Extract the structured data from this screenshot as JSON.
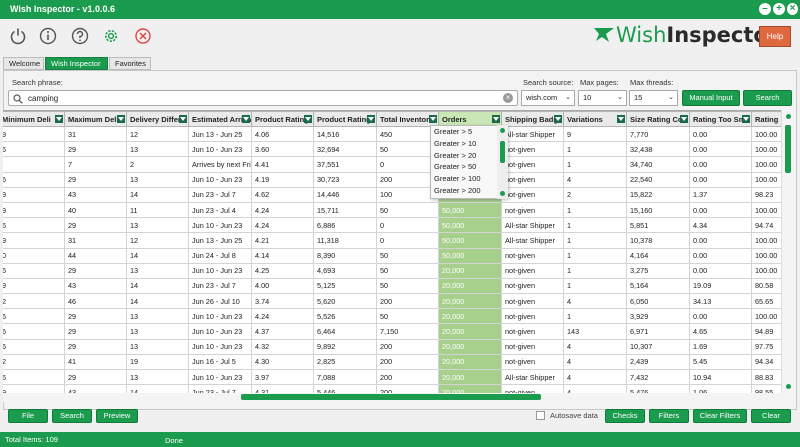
{
  "window": {
    "title": "Wish Inspector - v1.0.0.6"
  },
  "toolbar": {
    "icons": [
      "power-icon",
      "info-icon",
      "help-circle-icon",
      "gear-icon",
      "close-circle-icon"
    ]
  },
  "logo": {
    "part1": "Wish",
    "part2": "Inspector"
  },
  "help_label": "Help",
  "tabs": [
    "Welcome",
    "Wish Inspector",
    "Favorites"
  ],
  "search": {
    "phrase_label": "Search phrase:",
    "value": "camping",
    "source_label": "Search source:",
    "source_value": "wish.com",
    "pages_label": "Max pages:",
    "pages_value": "10",
    "threads_label": "Max threads:",
    "threads_value": "15",
    "manual_label": "Manual Input",
    "search_label": "Search"
  },
  "grid": {
    "columns": [
      "Minimum Deli",
      "Maximum Deli",
      "Delivery Differ",
      "Estimated Arrival",
      "Product Rating",
      "Product Rating",
      "Total Inventor",
      "Orders",
      "Shipping Badge",
      "Variations",
      "Size Rating Co",
      "Rating Too Sm",
      "Rating"
    ],
    "rows": [
      [
        "9",
        "31",
        "12",
        "Jun 13 - Jun 25",
        "4.06",
        "14,516",
        "450",
        "",
        "All-star Shipper",
        "9",
        "7,770",
        "0.00",
        "100.00"
      ],
      [
        "6",
        "29",
        "13",
        "Jun 10 - Jun 23",
        "3.60",
        "32,694",
        "50",
        "",
        "not-given",
        "1",
        "32,438",
        "0.00",
        "100.00"
      ],
      [
        "",
        "7",
        "2",
        "Arrives by next Fri",
        "4.41",
        "37,551",
        "0",
        "",
        "not-given",
        "1",
        "34,740",
        "0.00",
        "100.00"
      ],
      [
        "6",
        "29",
        "13",
        "Jun 10 - Jun 23",
        "4.19",
        "30,723",
        "200",
        "",
        "not-given",
        "4",
        "22,540",
        "0.00",
        "100.00"
      ],
      [
        "9",
        "43",
        "14",
        "Jun 23 - Jul 7",
        "4.62",
        "14,446",
        "100",
        "",
        "not-given",
        "2",
        "15,822",
        "1.37",
        "98.23"
      ],
      [
        "9",
        "40",
        "11",
        "Jun 23 - Jul 4",
        "4.24",
        "15,711",
        "50",
        "50,000",
        "not-given",
        "1",
        "15,160",
        "0.00",
        "100.00"
      ],
      [
        "6",
        "29",
        "13",
        "Jun 10 - Jun 23",
        "4.24",
        "6,886",
        "0",
        "50,000",
        "All-star Shipper",
        "1",
        "5,851",
        "4.34",
        "94.74"
      ],
      [
        "9",
        "31",
        "12",
        "Jun 13 - Jun 25",
        "4.21",
        "11,318",
        "0",
        "50,000",
        "All-star Shipper",
        "1",
        "10,378",
        "0.00",
        "100.00"
      ],
      [
        "0",
        "44",
        "14",
        "Jun 24 - Jul 8",
        "4.14",
        "8,390",
        "50",
        "50,000",
        "not-given",
        "1",
        "4,164",
        "0.00",
        "100.00"
      ],
      [
        "6",
        "29",
        "13",
        "Jun 10 - Jun 23",
        "4.25",
        "4,693",
        "50",
        "20,000",
        "not-given",
        "1",
        "3,275",
        "0.00",
        "100.00"
      ],
      [
        "9",
        "43",
        "14",
        "Jun 23 - Jul 7",
        "4.00",
        "5,125",
        "50",
        "20,000",
        "not-given",
        "1",
        "5,164",
        "19.09",
        "80.58"
      ],
      [
        "2",
        "46",
        "14",
        "Jun 26 - Jul 10",
        "3.74",
        "5,620",
        "200",
        "20,000",
        "not-given",
        "4",
        "6,050",
        "34.13",
        "65.65"
      ],
      [
        "6",
        "29",
        "13",
        "Jun 10 - Jun 23",
        "4.24",
        "5,526",
        "50",
        "20,000",
        "not-given",
        "1",
        "3,929",
        "0.00",
        "100.00"
      ],
      [
        "6",
        "29",
        "13",
        "Jun 10 - Jun 23",
        "4.37",
        "6,464",
        "7,150",
        "20,000",
        "not-given",
        "143",
        "6,971",
        "4.65",
        "94.89"
      ],
      [
        "6",
        "29",
        "13",
        "Jun 10 - Jun 23",
        "4.32",
        "9,892",
        "200",
        "20,000",
        "not-given",
        "4",
        "10,307",
        "1.69",
        "97.75"
      ],
      [
        "2",
        "41",
        "19",
        "Jun 16 - Jul 5",
        "4.30",
        "2,825",
        "200",
        "20,000",
        "not-given",
        "4",
        "2,439",
        "5.45",
        "94.34"
      ],
      [
        "6",
        "29",
        "13",
        "Jun 10 - Jun 23",
        "3.97",
        "7,088",
        "200",
        "20,000",
        "All-star Shipper",
        "4",
        "7,432",
        "10.94",
        "88.83"
      ],
      [
        "9",
        "43",
        "14",
        "Jun 23 - Jul 7",
        "4.31",
        "5,446",
        "200",
        "20,000",
        "not-given",
        "4",
        "5,476",
        "1.06",
        "98.55"
      ]
    ]
  },
  "orders_filter": [
    "Greater > 5",
    "Greater > 10",
    "Greater > 20",
    "Greater > 50",
    "Greater > 100",
    "Greater > 200"
  ],
  "bottom": {
    "file": "File",
    "search": "Search",
    "preview": "Preview",
    "autosave": "Autosave data",
    "checks": "Checks",
    "filters": "Filters",
    "clear_filters": "Clear Filters",
    "clear": "Clear"
  },
  "status": {
    "total": "Total Items: 109",
    "state": "Done"
  },
  "colors": {
    "accent": "#1b9b4e",
    "orders_bg": "#a8d08d",
    "help": "#e0683e"
  }
}
